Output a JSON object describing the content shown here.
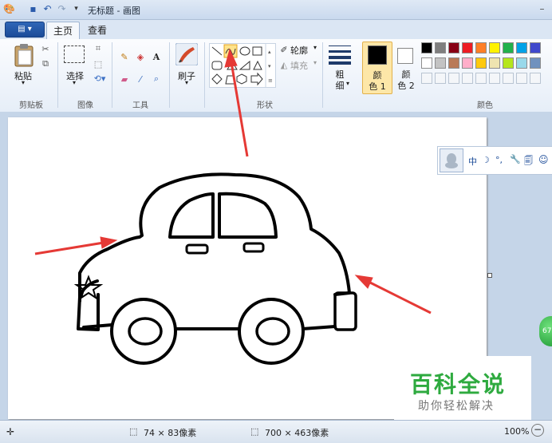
{
  "window": {
    "title": "无标题 - 画图"
  },
  "tabs": [
    {
      "label": "主页"
    },
    {
      "label": "查看"
    }
  ],
  "ribbon": {
    "clipboard": {
      "paste_label": "粘贴",
      "group_label": "剪贴板"
    },
    "image": {
      "select_label": "选择",
      "group_label": "图像"
    },
    "tools": {
      "group_label": "工具"
    },
    "brushes": {
      "label": "刷子"
    },
    "shapes": {
      "outline_label": "轮廓",
      "fill_label": "填充",
      "group_label": "形状"
    },
    "size": {
      "label_line1": "粗",
      "label_line2": "细"
    },
    "color1": {
      "label_line1": "颜",
      "label_line2": "色 1",
      "value": "#000000"
    },
    "color2": {
      "label_line1": "颜",
      "label_line2": "色 2",
      "value": "#ffffff"
    },
    "colors": {
      "group_label": "颜色",
      "row1": [
        "#000000",
        "#7f7f7f",
        "#880015",
        "#ed1c24",
        "#ff7f27",
        "#fff200",
        "#22b14c",
        "#00a2e8",
        "#3f48cc"
      ],
      "row2": [
        "#ffffff",
        "#c3c3c3",
        "#b97a57",
        "#ffaec9",
        "#ffc90e",
        "#efe4b0",
        "#b5e61d",
        "#99d9ea",
        "#7092be"
      ]
    }
  },
  "qq_toolbar": {
    "chars": [
      "中",
      "☽",
      "°,",
      "🔧",
      "🗐",
      "☺"
    ]
  },
  "status": {
    "selection_size": "74 × 83像素",
    "canvas_size": "700 × 463像素",
    "zoom": "100%",
    "round_badge": "67"
  },
  "watermark": {
    "line1": "百科全说",
    "line2": "助你轻松解决"
  },
  "colors": {
    "accent": "#1b4b98",
    "arrow": "#e53935",
    "watermark_green": "#2eaa3f"
  }
}
